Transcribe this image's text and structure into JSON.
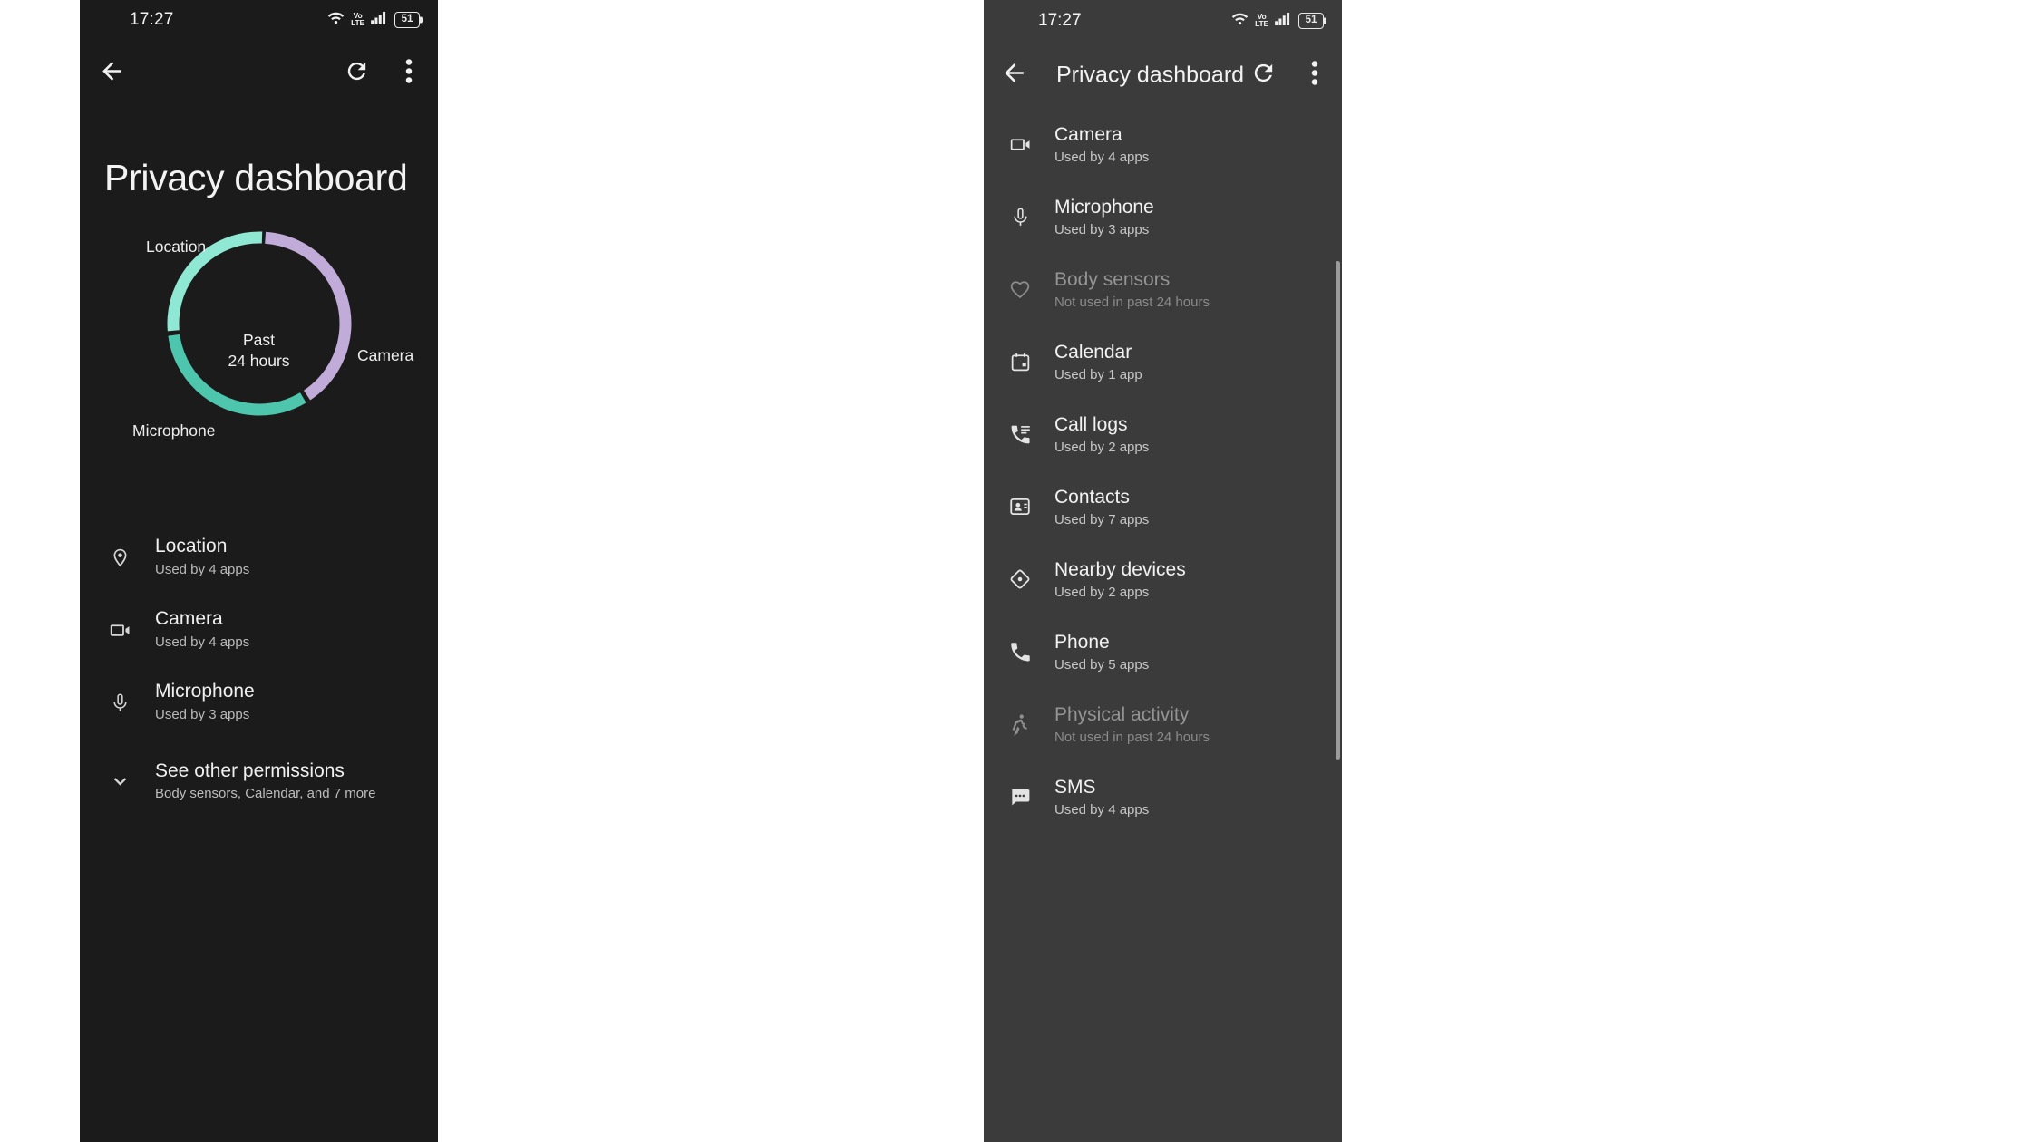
{
  "left_panel": {
    "status_bar": {
      "time": "17:27",
      "wifi_icon": "wifi-icon",
      "volte_top": "Vo",
      "volte_bottom": "LTE",
      "signal_icon": "cellular-signal-icon",
      "battery_level": "51"
    },
    "app_bar": {
      "back_icon": "back-arrow-icon",
      "refresh_icon": "refresh-icon",
      "more_icon": "more-vertical-icon"
    },
    "title": "Privacy dashboard",
    "chart_center_line1": "Past",
    "chart_center_line2": "24 hours",
    "permissions": [
      {
        "icon": "location-pin-icon",
        "title": "Location",
        "subtitle": "Used by 4 apps"
      },
      {
        "icon": "video-camera-icon",
        "title": "Camera",
        "subtitle": "Used by 4 apps"
      },
      {
        "icon": "microphone-icon",
        "title": "Microphone",
        "subtitle": "Used by 3 apps"
      }
    ],
    "see_other": {
      "icon": "chevron-down-icon",
      "title": "See other permissions",
      "subtitle": "Body sensors, Calendar, and 7 more"
    }
  },
  "right_panel": {
    "status_bar": {
      "time": "17:27",
      "wifi_icon": "wifi-icon",
      "volte_top": "Vo",
      "volte_bottom": "LTE",
      "signal_icon": "cellular-signal-icon",
      "battery_level": "51"
    },
    "app_bar": {
      "back_icon": "back-arrow-icon",
      "title": "Privacy dashboard",
      "refresh_icon": "refresh-icon",
      "more_icon": "more-vertical-icon"
    },
    "permissions": [
      {
        "icon": "video-camera-icon",
        "title": "Camera",
        "subtitle": "Used by 4 apps",
        "dimmed": false
      },
      {
        "icon": "microphone-icon",
        "title": "Microphone",
        "subtitle": "Used by 3 apps",
        "dimmed": false
      },
      {
        "icon": "heart-icon",
        "title": "Body sensors",
        "subtitle": "Not used in past 24 hours",
        "dimmed": true
      },
      {
        "icon": "calendar-icon",
        "title": "Calendar",
        "subtitle": "Used by 1 app",
        "dimmed": false
      },
      {
        "icon": "call-logs-icon",
        "title": "Call logs",
        "subtitle": "Used by 2 apps",
        "dimmed": false
      },
      {
        "icon": "contacts-icon",
        "title": "Contacts",
        "subtitle": "Used by 7 apps",
        "dimmed": false
      },
      {
        "icon": "nearby-devices-icon",
        "title": "Nearby devices",
        "subtitle": "Used by 2 apps",
        "dimmed": false
      },
      {
        "icon": "phone-icon",
        "title": "Phone",
        "subtitle": "Used by 5 apps",
        "dimmed": false
      },
      {
        "icon": "running-person-icon",
        "title": "Physical activity",
        "subtitle": "Not used in past 24 hours",
        "dimmed": true
      },
      {
        "icon": "sms-message-icon",
        "title": "SMS",
        "subtitle": "Used by 4 apps",
        "dimmed": false
      }
    ],
    "scrollbar": "vertical-scrollbar"
  },
  "chart_data": {
    "type": "pie",
    "title": "Past 24 hours",
    "categories": [
      "Location",
      "Camera",
      "Microphone"
    ],
    "values": [
      40,
      28,
      32
    ],
    "colors": [
      "#c0abd9",
      "#8fe8d4",
      "#4ec5ad"
    ],
    "labels": [
      "Location",
      "Camera",
      "Microphone"
    ],
    "center_text": "Past 24 hours",
    "legend": "inline-labels",
    "donut": true
  }
}
